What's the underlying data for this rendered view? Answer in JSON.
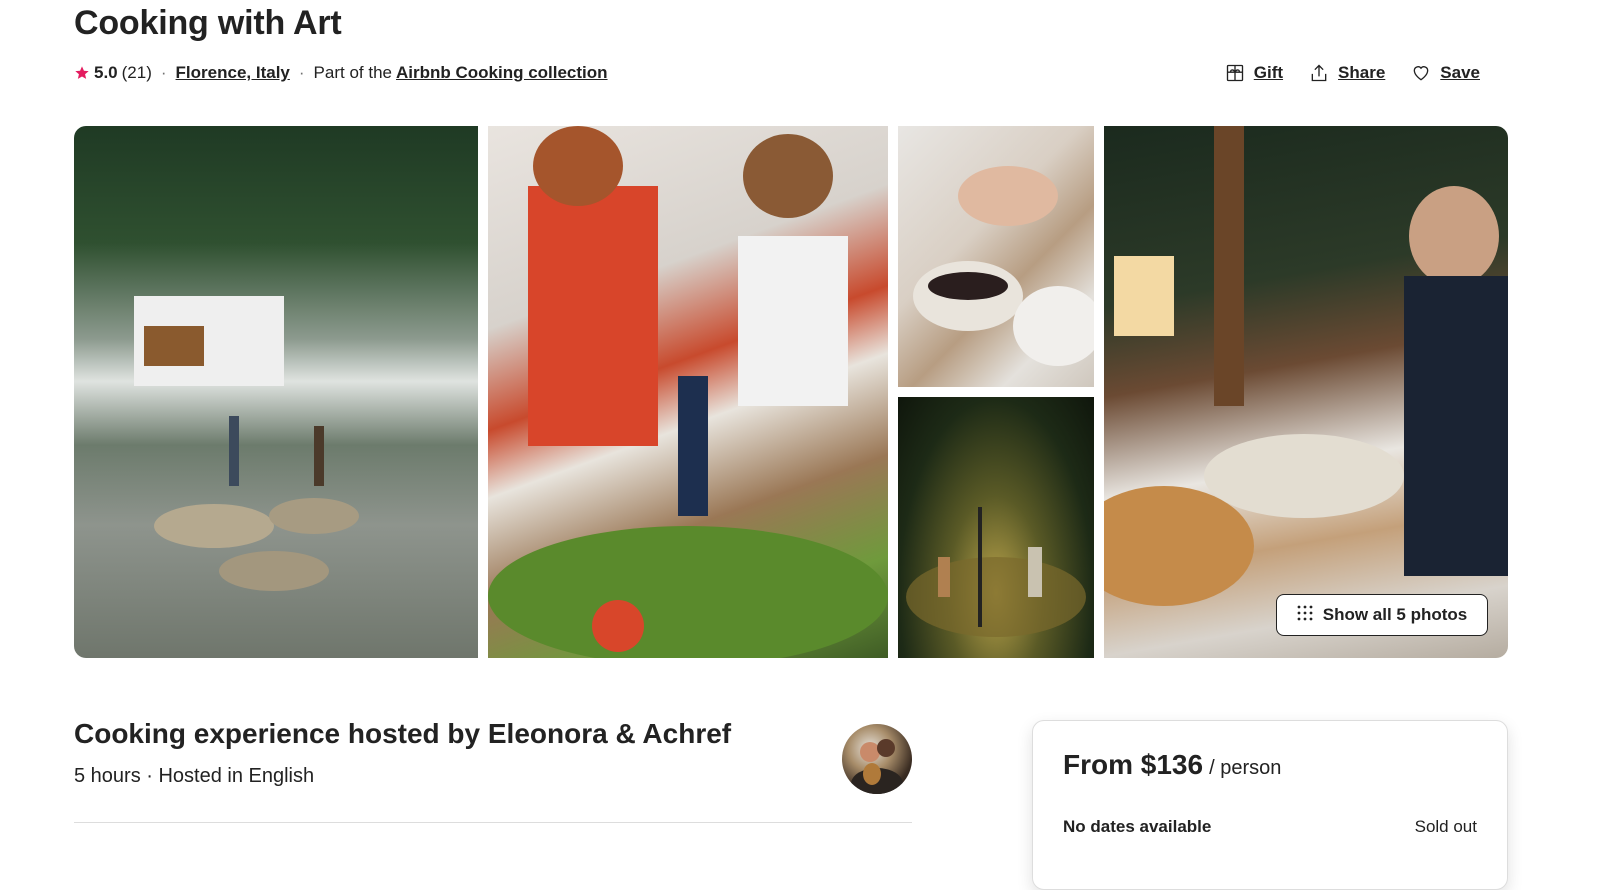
{
  "listing": {
    "title": "Cooking with Art",
    "rating": "5.0",
    "review_count": "(21)",
    "location": "Florence, Italy",
    "collection_prefix": "Part of the",
    "collection": "Airbnb Cooking collection",
    "separator": "·"
  },
  "actions": {
    "gift": "Gift",
    "share": "Share",
    "save": "Save"
  },
  "gallery": {
    "show_all": "Show all 5 photos",
    "photo_count": 5
  },
  "host": {
    "title": "Cooking experience hosted by Eleonora & Achref",
    "subtitle": "5 hours · Hosted in English"
  },
  "booking": {
    "price": "From $136",
    "unit": "/ person",
    "availability": "No dates available",
    "status": "Sold out"
  },
  "colors": {
    "text": "#222222",
    "star": "#e31c5f",
    "divider": "#dddddd"
  },
  "icons": [
    "star-icon",
    "gift-icon",
    "share-icon",
    "heart-icon",
    "grid-dots-icon"
  ]
}
